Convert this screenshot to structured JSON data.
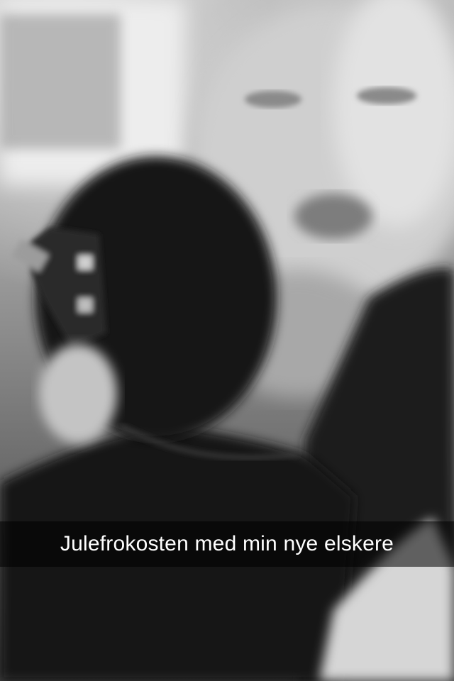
{
  "snap": {
    "caption": "Julefrokosten med min nye elskere"
  }
}
